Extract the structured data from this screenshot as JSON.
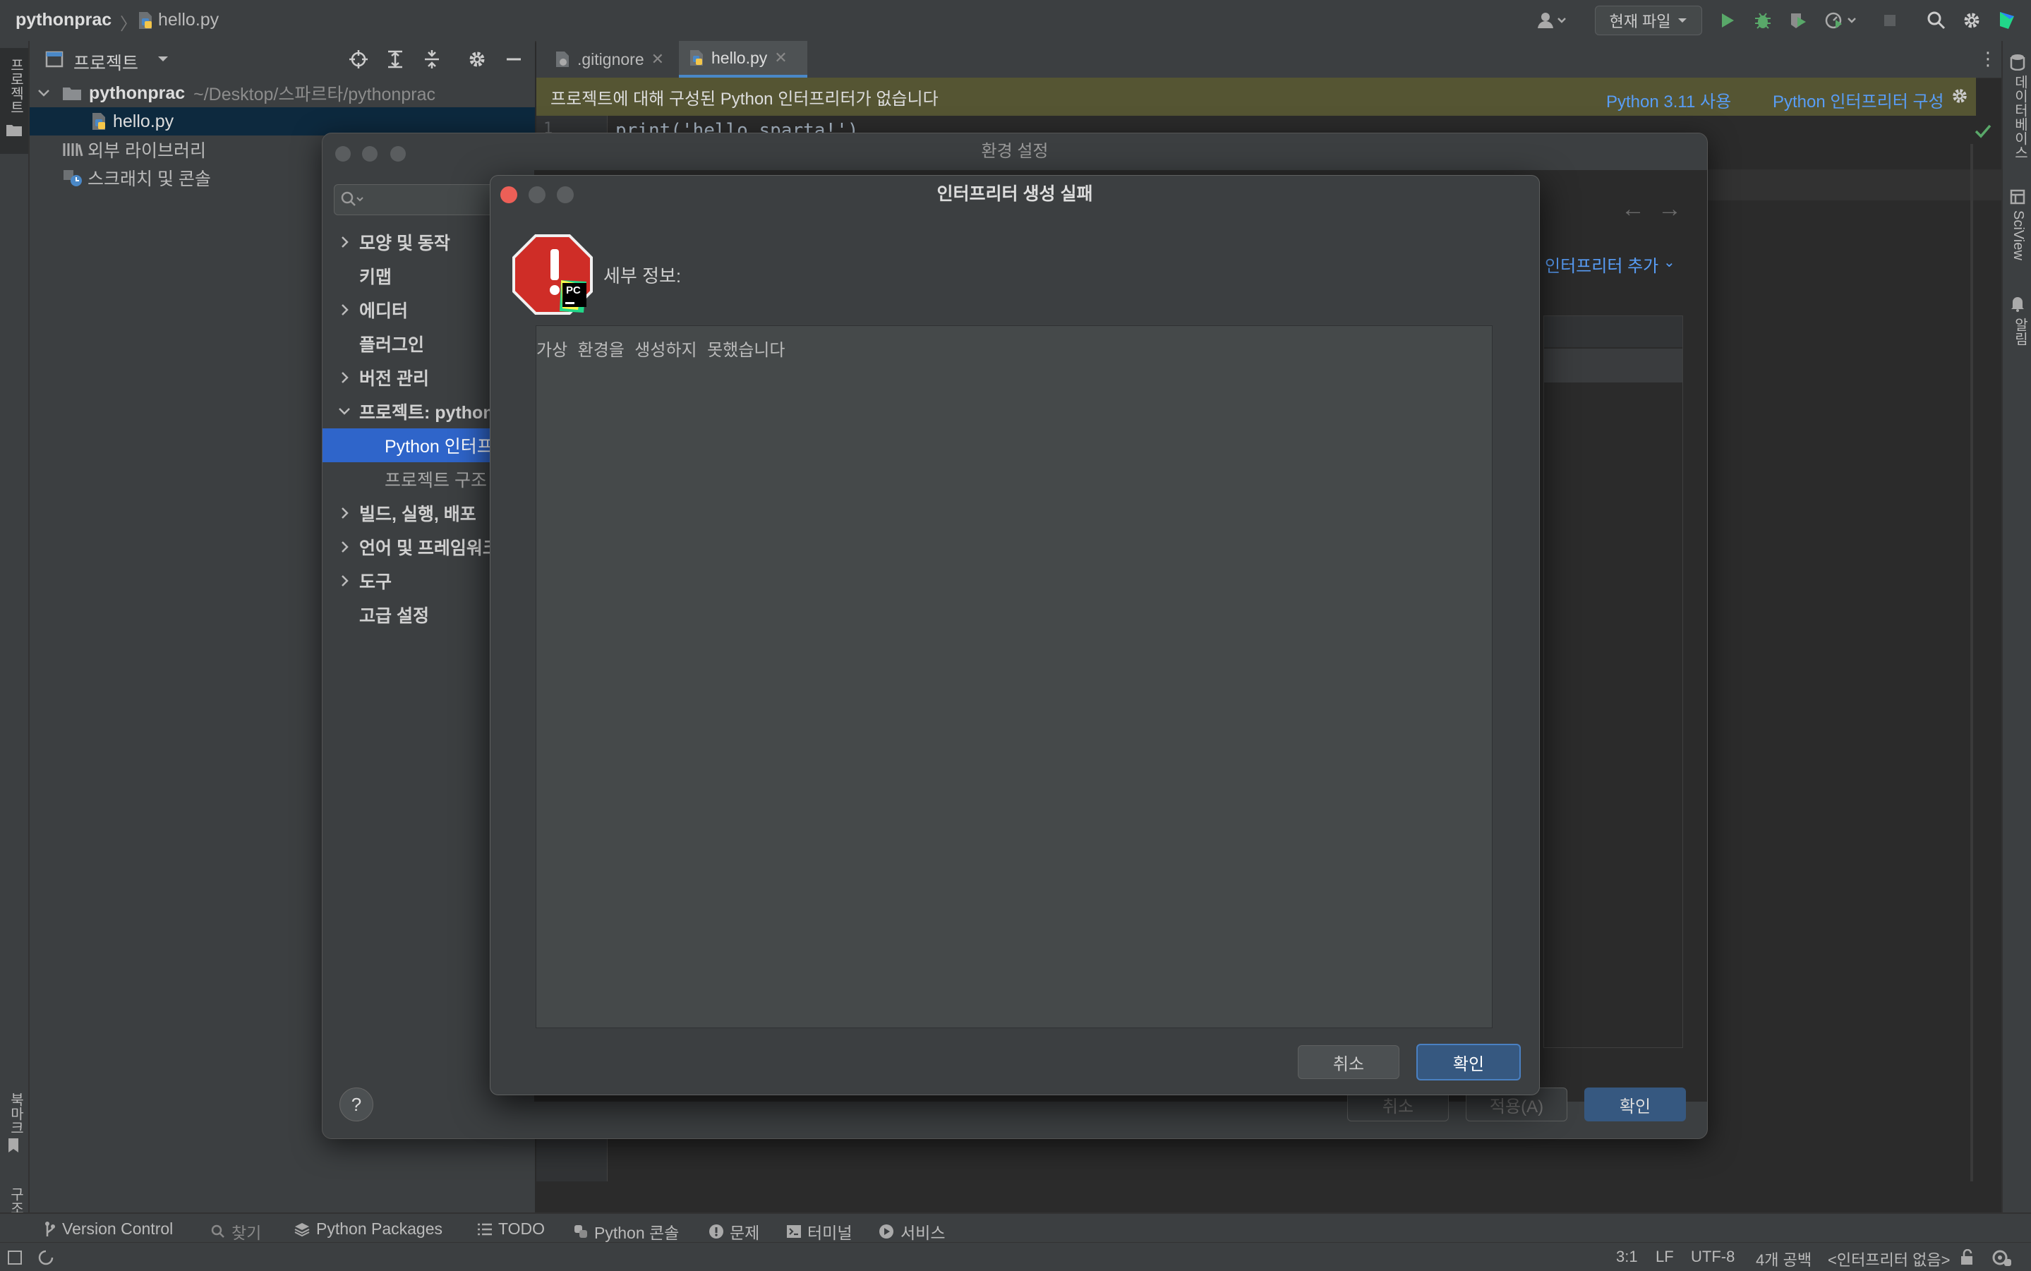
{
  "titlebar": {
    "project": "pythonprac",
    "file": "hello.py",
    "run_config": "현재 파일"
  },
  "left_strip": {
    "project_label": "프로젝트",
    "bookmarks_label": "북마크",
    "structure_label": "구조"
  },
  "right_strip": {
    "database_label": "데이터베이스",
    "sciview_label": "SciView",
    "notifications_label": "알림"
  },
  "project_panel": {
    "title": "프로젝트",
    "tree": [
      {
        "name": "pythonprac",
        "path": "~/Desktop/스파르타/pythonprac"
      },
      {
        "name": "hello.py"
      },
      {
        "name": "외부 라이브러리"
      },
      {
        "name": "스크래치 및 콘솔"
      }
    ]
  },
  "editor": {
    "tabs": [
      {
        "label": ".gitignore"
      },
      {
        "label": "hello.py"
      }
    ],
    "banner": {
      "message": "프로젝트에 대해 구성된 Python 인터프리터가 없습니다",
      "link1": "Python 3.11 사용",
      "link2": "Python 인터프리터 구성"
    },
    "line_number": "1",
    "code": "print('hello sparta!')"
  },
  "settings_dialog": {
    "title": "환경 설정",
    "search_placeholder": "Q",
    "nav": [
      {
        "label": "모양 및 동작",
        "expandable": true
      },
      {
        "label": "키맵",
        "expandable": false
      },
      {
        "label": "에디터",
        "expandable": true
      },
      {
        "label": "플러그인",
        "expandable": false
      },
      {
        "label": "버전 관리",
        "expandable": true
      },
      {
        "label": "프로젝트: pythonprac",
        "expandable": true,
        "expanded": true
      },
      {
        "label": "Python 인터프리터",
        "child": true,
        "selected": true
      },
      {
        "label": "프로젝트 구조",
        "child": true
      },
      {
        "label": "빌드, 실행, 배포",
        "expandable": true
      },
      {
        "label": "언어 및 프레임워크",
        "expandable": true
      },
      {
        "label": "도구",
        "expandable": true
      },
      {
        "label": "고급 설정",
        "expandable": false
      }
    ],
    "add_interpreter": "인터프리터 추가",
    "help": "?",
    "cancel": "취소",
    "apply": "적용(A)",
    "ok": "확인"
  },
  "error_dialog": {
    "title": "인터프리터 생성 실패",
    "details_label": "세부 정보:",
    "badge": "PC",
    "message": "가상 환경을 생성하지 못했습니다",
    "cancel": "취소",
    "ok": "확인"
  },
  "bottom_tools": [
    {
      "label": "Version Control"
    },
    {
      "label": "찾기"
    },
    {
      "label": "Python Packages"
    },
    {
      "label": "TODO"
    },
    {
      "label": "Python 콘솔"
    },
    {
      "label": "문제"
    },
    {
      "label": "터미널"
    },
    {
      "label": "서비스"
    }
  ],
  "status": {
    "position": "3:1",
    "line_sep": "LF",
    "encoding": "UTF-8",
    "indent": "4개 공백",
    "interpreter": "<인터프리터 없음>"
  },
  "colors": {
    "accent": "#2f65ca",
    "banner_bg": "#555533",
    "link": "#589df6",
    "error_red": "#d0302a",
    "run_green": "#59a869"
  }
}
